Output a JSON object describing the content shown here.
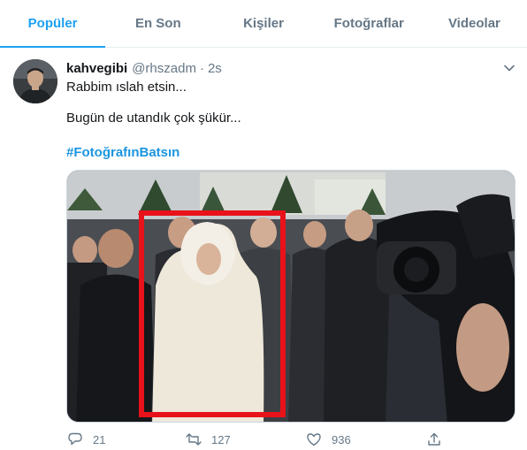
{
  "tabs": [
    {
      "label": "Popüler",
      "active": true
    },
    {
      "label": "En Son"
    },
    {
      "label": "Kişiler"
    },
    {
      "label": "Fotoğraflar"
    },
    {
      "label": "Videolar"
    }
  ],
  "tweet": {
    "name": "kahvegibi",
    "handle": "@rhszadm",
    "separator": "·",
    "time": "2s",
    "lines": [
      "Rabbim ıslah etsin...",
      "Bugün de utandık çok şükür..."
    ],
    "hashtag": "#FotoğrafınBatsın",
    "counts": {
      "replies": "21",
      "retweets": "127",
      "likes": "936"
    }
  },
  "colors": {
    "accent": "#1da1f2",
    "hashtag": "#1b95e0",
    "secondary_text": "#657786",
    "highlight_box": "#e8121b"
  },
  "icons": [
    "chevron-down-icon",
    "reply-icon",
    "retweet-icon",
    "like-icon",
    "share-icon"
  ]
}
